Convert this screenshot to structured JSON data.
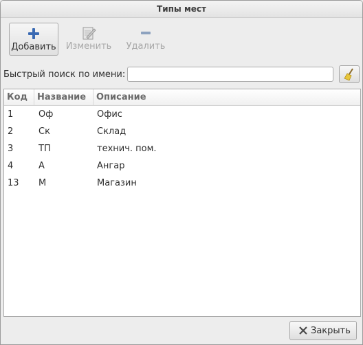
{
  "window": {
    "title": "Типы мест"
  },
  "toolbar": {
    "add_label": "Добавить",
    "edit_label": "Изменить",
    "delete_label": "Удалить"
  },
  "search": {
    "label": "Быстрый поиск по имени:",
    "value": "",
    "placeholder": ""
  },
  "table": {
    "columns": [
      "Код",
      "Название",
      "Описание"
    ],
    "rows": [
      [
        "1",
        "Оф",
        "Офис"
      ],
      [
        "2",
        "Ск",
        "Склад"
      ],
      [
        "3",
        "ТП",
        "технич. пом."
      ],
      [
        "4",
        "А",
        "Ангар"
      ],
      [
        "13",
        "М",
        "Магазин"
      ]
    ]
  },
  "footer": {
    "close_label": "Закрыть"
  },
  "icons": {
    "add": "plus-icon",
    "edit": "notepad-pencil-icon",
    "delete": "minus-icon",
    "clear": "broom-icon",
    "close": "close-x-icon"
  },
  "colors": {
    "accent": "#3a6ab3"
  }
}
